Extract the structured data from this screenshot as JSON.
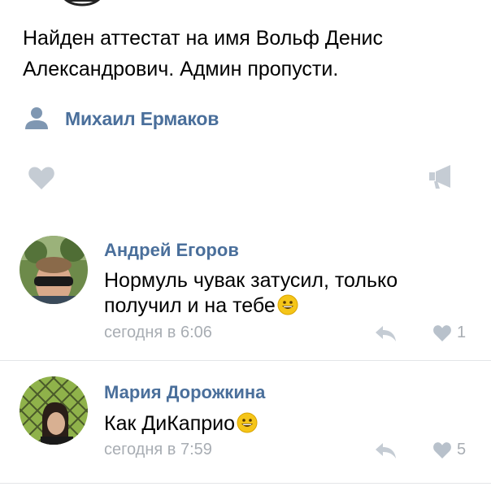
{
  "post": {
    "text_line1": "Найден аттестат на имя Вольф Денис",
    "text_line2": "Александрович. Админ пропусти.",
    "signer_name": "Михаил Ермаков",
    "icons": {
      "signer": "person-icon",
      "like": "heart-icon",
      "share": "megaphone-icon"
    }
  },
  "comments": [
    {
      "author": "Андрей Егоров",
      "text_line1": "Нормуль чувак затусил, только",
      "text_line2": "получил и на тебе",
      "emoji": "grinning-face-emoji",
      "time": "сегодня в 6:06",
      "likes": "1"
    },
    {
      "author": "Мария Дорожкина",
      "text_line1": "Как ДиКаприо",
      "emoji": "grinning-face-emoji",
      "time": "сегодня в 7:59",
      "likes": "5"
    }
  ],
  "colors": {
    "link": "#4a6f9b",
    "muted": "#a8adb3",
    "icon": "#c5ccd4",
    "divider": "#e3e5e8",
    "emoji": "#f5c518"
  }
}
